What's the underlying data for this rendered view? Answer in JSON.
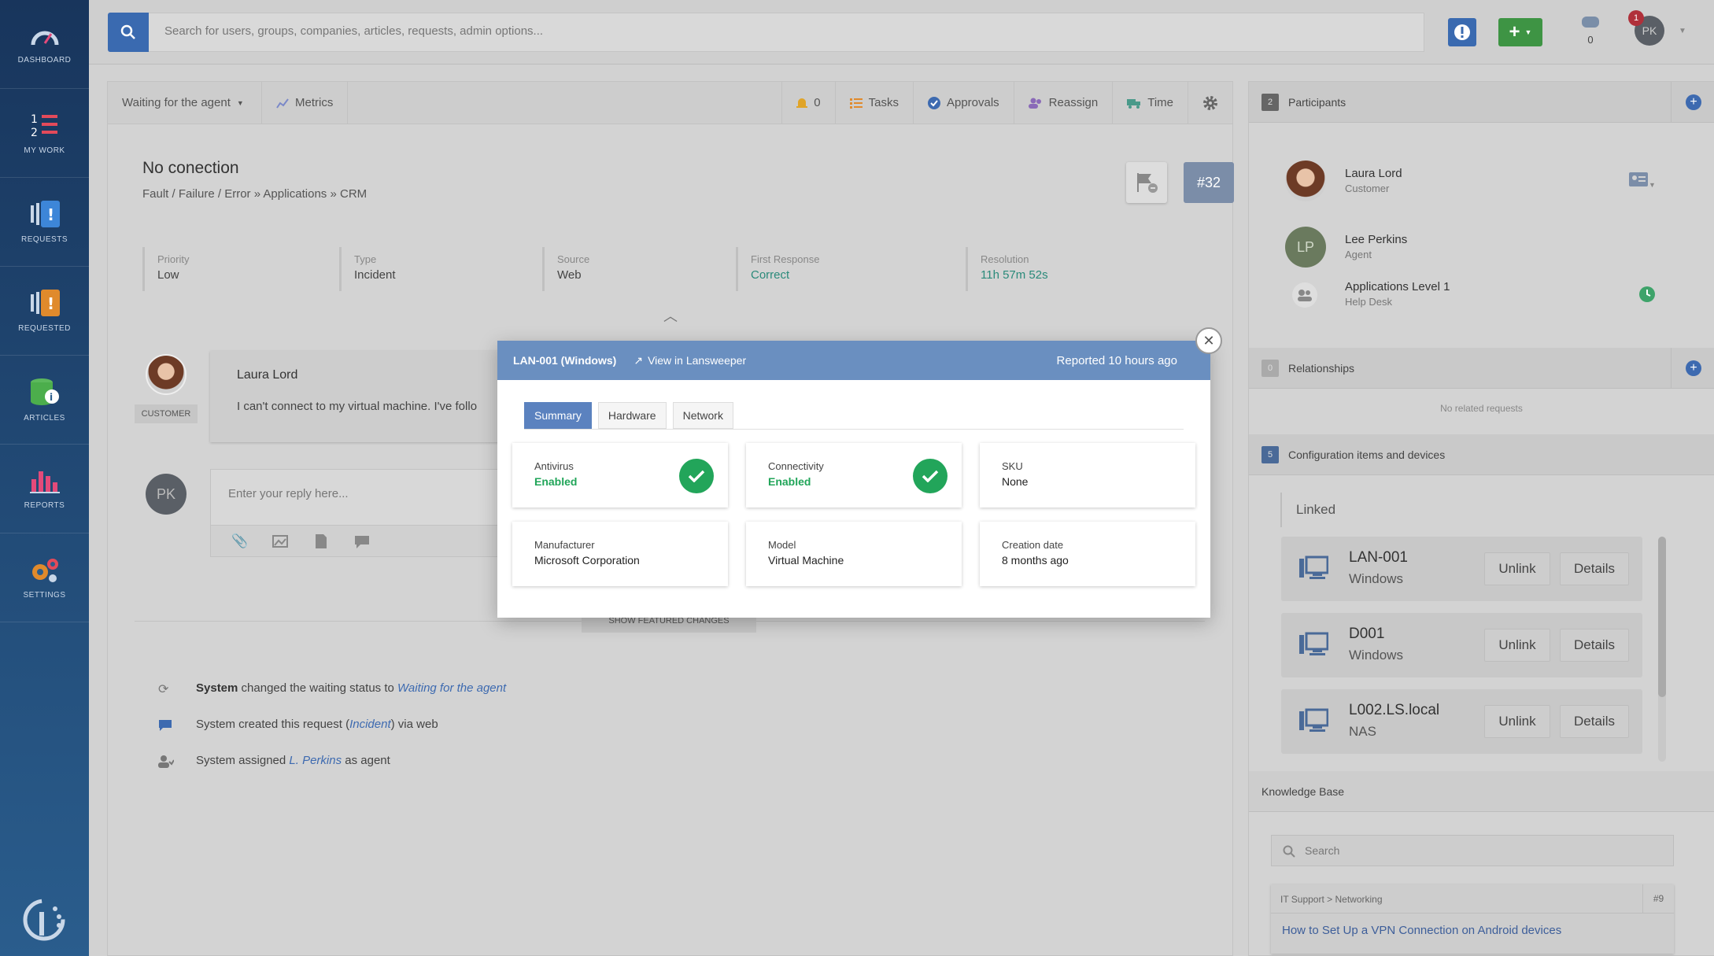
{
  "sidebar": {
    "items": [
      {
        "label": "DASHBOARD"
      },
      {
        "label": "MY WORK"
      },
      {
        "label": "REQUESTS"
      },
      {
        "label": "REQUESTED"
      },
      {
        "label": "ARTICLES"
      },
      {
        "label": "REPORTS"
      },
      {
        "label": "SETTINGS"
      }
    ]
  },
  "topbar": {
    "search_placeholder": "Search for users, groups, companies, articles, requests, admin options...",
    "notif_count": "0",
    "badge": "1",
    "avatar": "PK"
  },
  "toolbar": {
    "status": "Waiting for the agent",
    "metrics": "Metrics",
    "bell": "0",
    "tasks": "Tasks",
    "approvals": "Approvals",
    "reassign": "Reassign",
    "time": "Time"
  },
  "request": {
    "title": "No conection",
    "crumb1": "Fault / Failure / Error",
    "sep1": "»",
    "crumb2": "Applications",
    "sep2": "»",
    "crumb3": "CRM",
    "id": "#32"
  },
  "meta": [
    {
      "label": "Priority",
      "value": "Low"
    },
    {
      "label": "Type",
      "value": "Incident"
    },
    {
      "label": "Source",
      "value": "Web"
    },
    {
      "label": "First Response",
      "value": "Correct"
    },
    {
      "label": "Resolution",
      "value": "11h 57m 52s"
    }
  ],
  "conversation": {
    "author": "Laura Lord",
    "role": "CUSTOMER",
    "text": "I can't connect to my virtual  machine. I've follo",
    "reply_placeholder": "Enter your reply here...",
    "reply_avatar": "PK",
    "featured": "SHOW FEATURED CHANGES"
  },
  "activity": [
    {
      "pre": "",
      "actor": "System",
      "mid": " changed the waiting status to ",
      "link": "Waiting for the agent",
      "post": ""
    },
    {
      "pre": "System created this request (",
      "actor": "",
      "mid": "",
      "link": "Incident",
      "post": ") via web"
    },
    {
      "pre": "System assigned ",
      "actor": "",
      "mid": "",
      "link": "L. Perkins",
      "post": " as agent"
    }
  ],
  "modal": {
    "title": "LAN-001 (Windows)",
    "link": "View in Lansweeper",
    "reported": "Reported 10 hours ago",
    "tabs": [
      "Summary",
      "Hardware",
      "Network"
    ],
    "cards": [
      {
        "label": "Antivirus",
        "value": "Enabled"
      },
      {
        "label": "Connectivity",
        "value": "Enabled"
      },
      {
        "label": "SKU",
        "value": "None"
      },
      {
        "label": "Manufacturer",
        "value": "Microsoft Corporation"
      },
      {
        "label": "Model",
        "value": "Virtual Machine"
      },
      {
        "label": "Creation date",
        "value": "8 months ago"
      }
    ]
  },
  "participants": {
    "count": "2",
    "title": "Participants",
    "people": [
      {
        "name": "Laura Lord",
        "role": "Customer"
      },
      {
        "name": "Lee Perkins",
        "role": "Agent",
        "initials": "LP"
      },
      {
        "name": "Applications Level 1",
        "role": "Help Desk"
      }
    ]
  },
  "relationships": {
    "count": "0",
    "title": "Relationships",
    "empty": "No related requests"
  },
  "config": {
    "count": "5",
    "title": "Configuration items and devices",
    "linked": "Linked",
    "unlink": "Unlink",
    "details": "Details",
    "items": [
      {
        "name": "LAN-001",
        "sub": "Windows"
      },
      {
        "name": "D001",
        "sub": "Windows"
      },
      {
        "name": "L002.LS.local",
        "sub": "NAS"
      }
    ]
  },
  "kb": {
    "title": "Knowledge Base",
    "placeholder": "Search",
    "cat": "IT Support > Networking",
    "num": "#9",
    "article": "How to Set Up a VPN Connection on Android devices"
  }
}
